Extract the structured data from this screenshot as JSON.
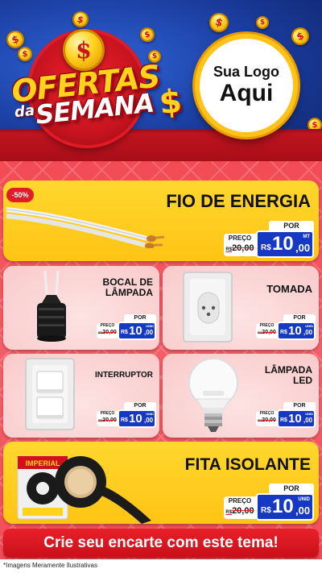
{
  "header": {
    "title_line1": "OFERTAS",
    "title_da": "da",
    "title_line2": "SEMANA",
    "title_dollar": "$",
    "coin_symbol": "$",
    "logo_line1": "Sua Logo",
    "logo_line2": "Aqui"
  },
  "colors": {
    "accent_red": "#e01d27",
    "accent_yellow": "#ffc414",
    "price_blue": "#1639c4",
    "header_blue": "#1a3c9e"
  },
  "products": [
    {
      "name": "FIO DE ENERGIA",
      "badge": "-50%",
      "por": "POR",
      "preco_label": "PREÇO",
      "old_prefix": "R$",
      "old_price": "20,00",
      "currency": "R$",
      "price_int": "10",
      "price_dec": ",00",
      "unit": "MT",
      "icon": "cable-icon"
    },
    {
      "name_line1": "BOCAL DE",
      "name_line2": "LÂMPADA",
      "por": "POR",
      "preco_label": "PREÇO",
      "old_prefix": "R$",
      "old_price": "20,00",
      "currency": "R$",
      "price_int": "10",
      "price_dec": ",00",
      "unit": "UNID",
      "icon": "lamp-socket-icon"
    },
    {
      "name": "TOMADA",
      "por": "POR",
      "preco_label": "PREÇO",
      "old_prefix": "R$",
      "old_price": "20,00",
      "currency": "R$",
      "price_int": "10",
      "price_dec": ",00",
      "unit": "UNID",
      "icon": "outlet-icon"
    },
    {
      "name": "INTERRUPTOR",
      "por": "POR",
      "preco_label": "PREÇO",
      "old_prefix": "R$",
      "old_price": "20,00",
      "currency": "R$",
      "price_int": "10",
      "price_dec": ",00",
      "unit": "UNID",
      "icon": "switch-icon"
    },
    {
      "name_line1": "LÂMPADA",
      "name_line2": "LED",
      "por": "POR",
      "preco_label": "PREÇO",
      "old_prefix": "R$",
      "old_price": "20,00",
      "currency": "R$",
      "price_int": "10",
      "price_dec": ",00",
      "unit": "UNID",
      "icon": "led-bulb-icon"
    },
    {
      "name": "FITA ISOLANTE",
      "por": "POR",
      "preco_label": "PREÇO",
      "old_prefix": "R$",
      "old_price": "20,00",
      "currency": "R$",
      "price_int": "10",
      "price_dec": ",00",
      "unit": "UNID",
      "icon": "tape-icon",
      "brand": "IMPERIAL"
    }
  ],
  "footer": {
    "cta": "Crie seu encarte com este tema!",
    "disclaimer": "*Imagens Meramente Ilustrativas"
  }
}
